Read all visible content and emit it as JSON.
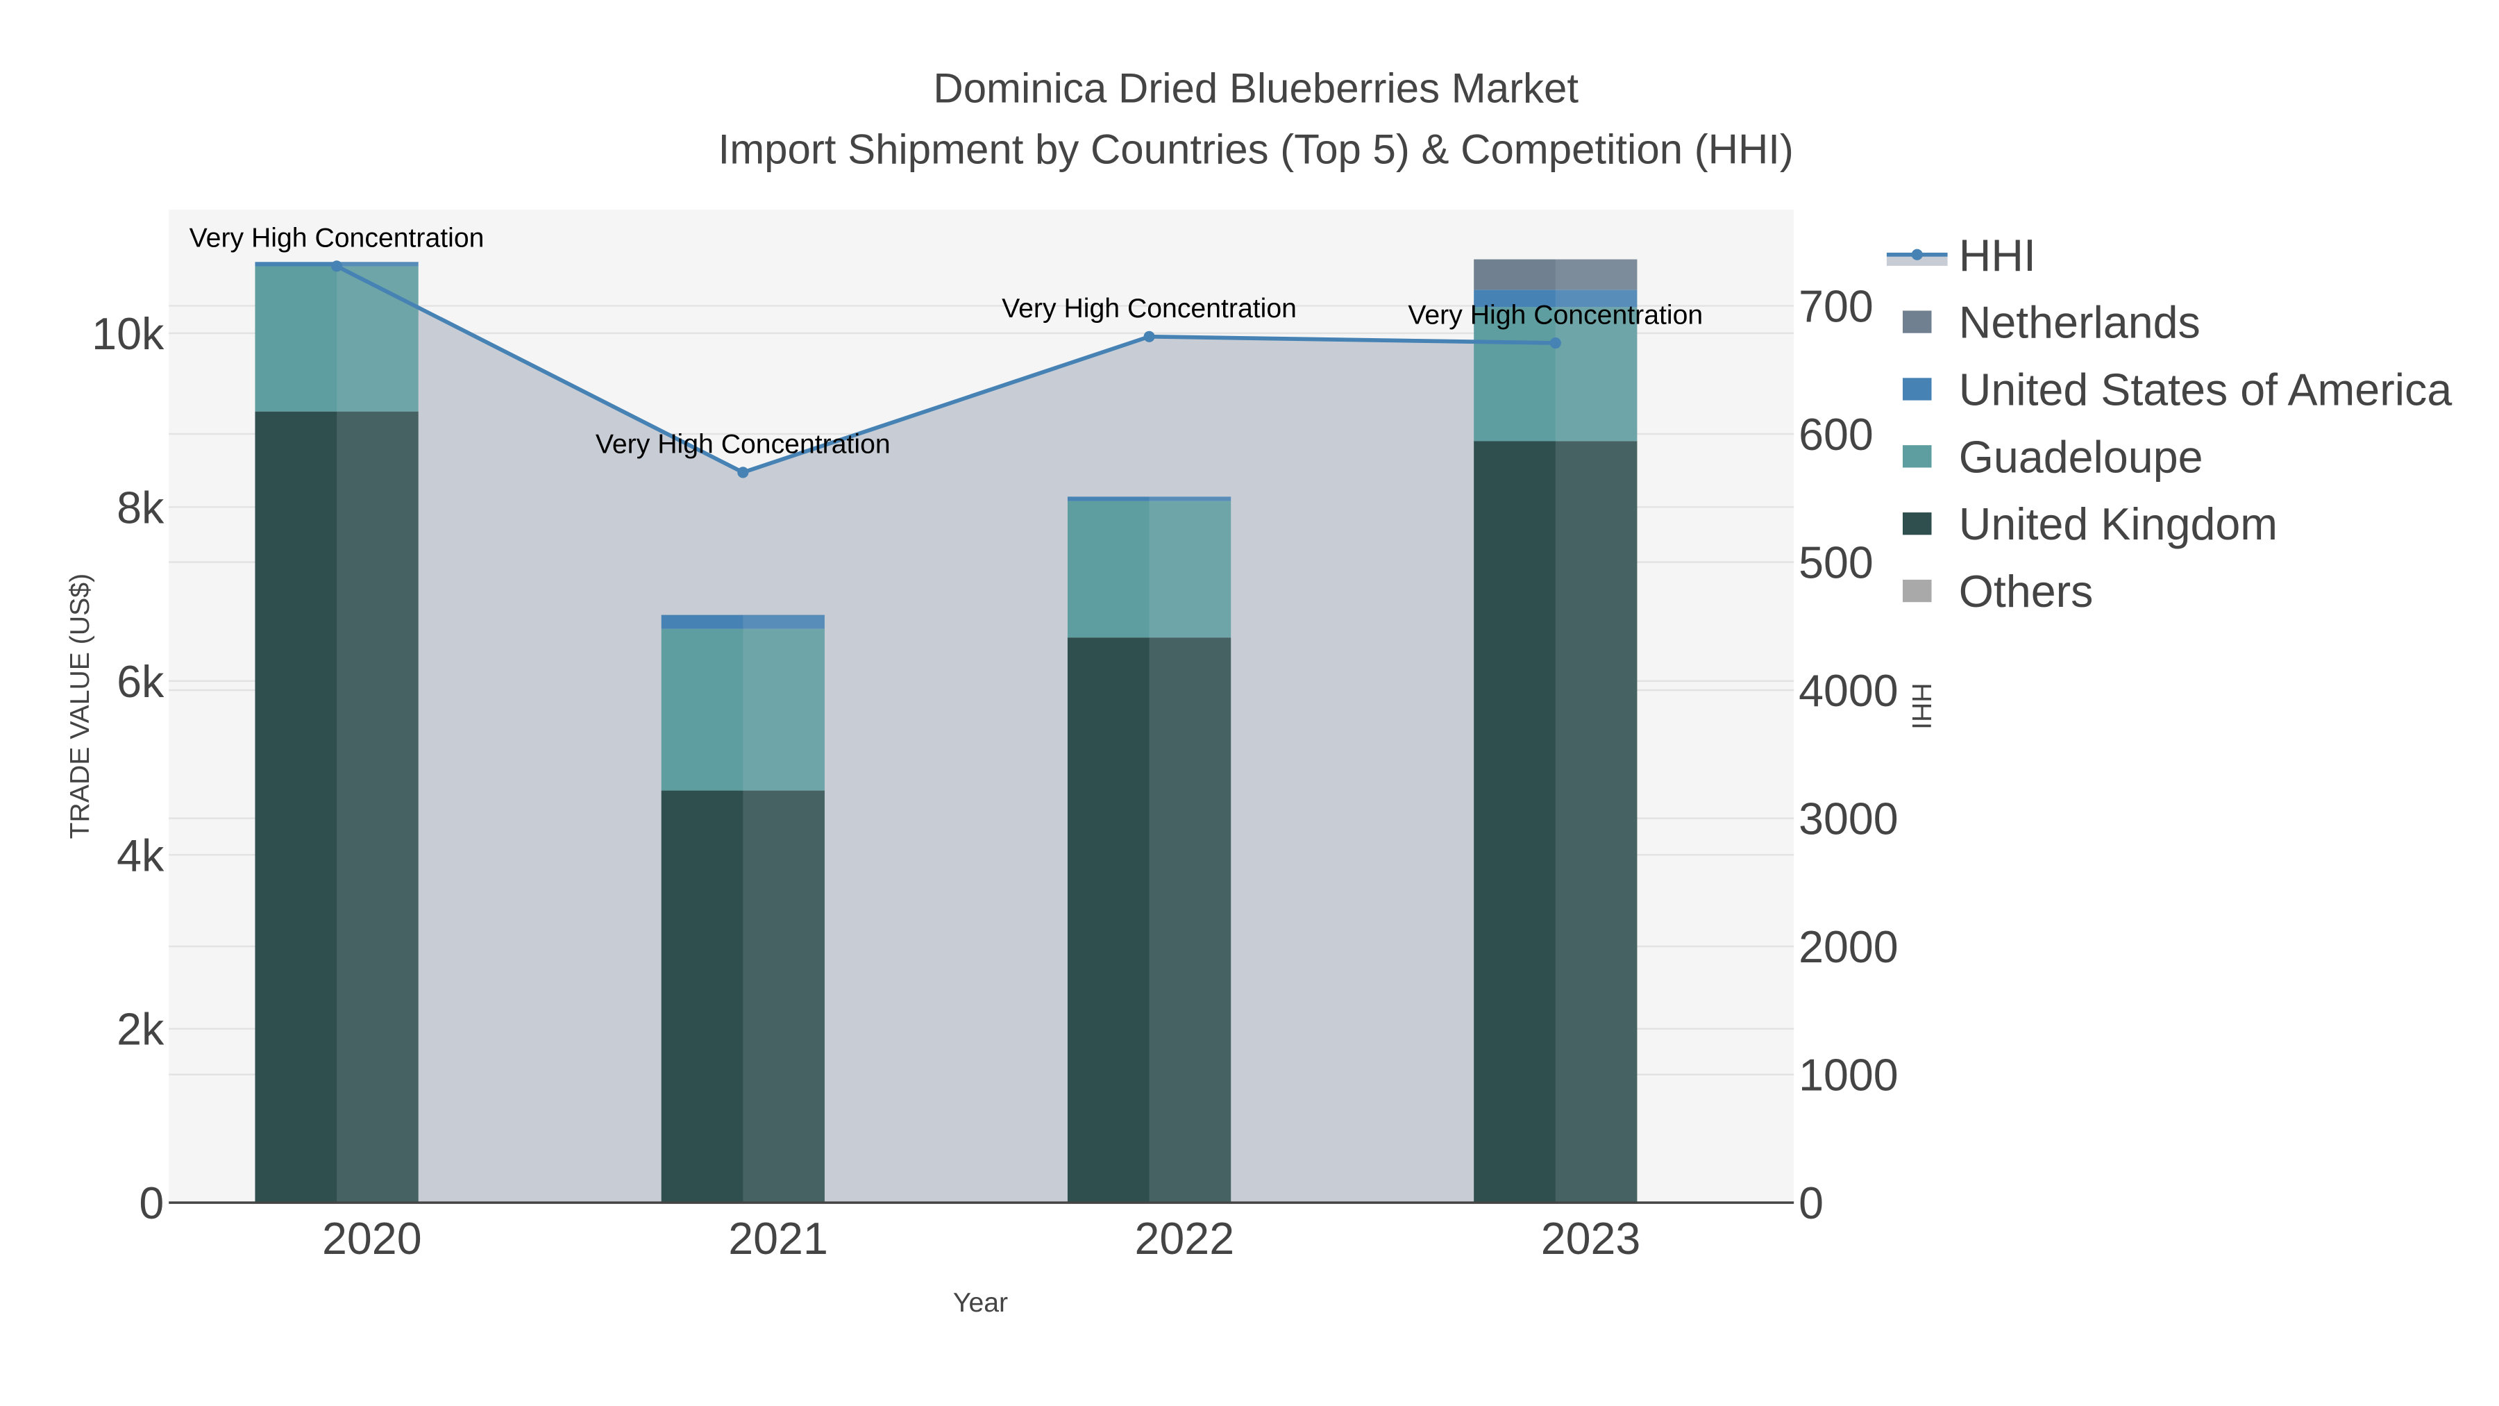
{
  "chart_data": {
    "type": "bar",
    "title": "Dominica Dried Blueberries Market",
    "subtitle": "Import Shipment by Countries (Top 5) & Competition (HHI)",
    "xlabel": "Year",
    "ylabel": "TRADE VALUE (US$)",
    "y2label": "HHI",
    "categories": [
      "2020",
      "2021",
      "2022",
      "2023"
    ],
    "ylim": [
      0,
      11420
    ],
    "y2lim": [
      0,
      7750
    ],
    "yticks": [
      {
        "v": 0,
        "label": "0"
      },
      {
        "v": 2000,
        "label": "2k"
      },
      {
        "v": 4000,
        "label": "4k"
      },
      {
        "v": 6000,
        "label": "6k"
      },
      {
        "v": 8000,
        "label": "8k"
      },
      {
        "v": 10000,
        "label": "10k"
      }
    ],
    "y2ticks": [
      {
        "v": 0,
        "label": "0"
      },
      {
        "v": 1000,
        "label": "1000"
      },
      {
        "v": 2000,
        "label": "2000"
      },
      {
        "v": 3000,
        "label": "3000"
      },
      {
        "v": 4000,
        "label": "4000"
      },
      {
        "v": 5000,
        "label": "500"
      },
      {
        "v": 6000,
        "label": "600"
      },
      {
        "v": 7000,
        "label": "700"
      }
    ],
    "grid": true,
    "legend_position": "right",
    "series": [
      {
        "name": "United Kingdom",
        "color": "#2f4f4f",
        "values": [
          9100,
          4740,
          6500,
          8760
        ]
      },
      {
        "name": "Guadeloupe",
        "color": "#5f9ea0",
        "values": [
          1670,
          1860,
          1570,
          1540
        ]
      },
      {
        "name": "United States of America",
        "color": "#4682b4",
        "values": [
          50,
          160,
          50,
          200
        ]
      },
      {
        "name": "Netherlands",
        "color": "#708090",
        "values": [
          0,
          0,
          0,
          350
        ]
      },
      {
        "name": "Others",
        "color": "#a9a9a9",
        "values": [
          0,
          0,
          0,
          0
        ]
      }
    ],
    "hhi": {
      "name": "HHI",
      "color": "#4682b4",
      "values": [
        7310,
        5700,
        6760,
        6710
      ]
    },
    "annotations": [
      "Very High Concentration",
      "Very High Concentration",
      "Very High Concentration",
      "Very High Concentration"
    ],
    "legend_order": [
      "HHI",
      "Netherlands",
      "United States of America",
      "Guadeloupe",
      "United Kingdom",
      "Others"
    ]
  }
}
